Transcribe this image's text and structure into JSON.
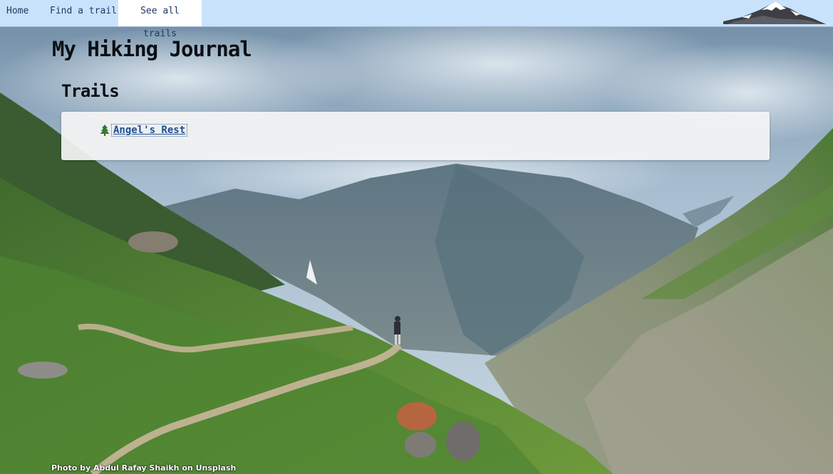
{
  "nav": {
    "home_label": "Home",
    "find_label": "Find a trail",
    "all_label": "See all trails"
  },
  "logo_icon": "snow-mountain-logo",
  "site_title": "My Hiking Journal",
  "section_title": "Trails",
  "trails": [
    {
      "icon": "evergreen-tree-icon",
      "name": "Angel's Rest"
    }
  ],
  "photo_credit": "Photo by Abdul Rafay Shaikh on Unsplash",
  "colors": {
    "nav_background": "#c9e2fb",
    "nav_active": "#ffffff",
    "link": "#1d4f91",
    "heading": "#0b0f14"
  }
}
